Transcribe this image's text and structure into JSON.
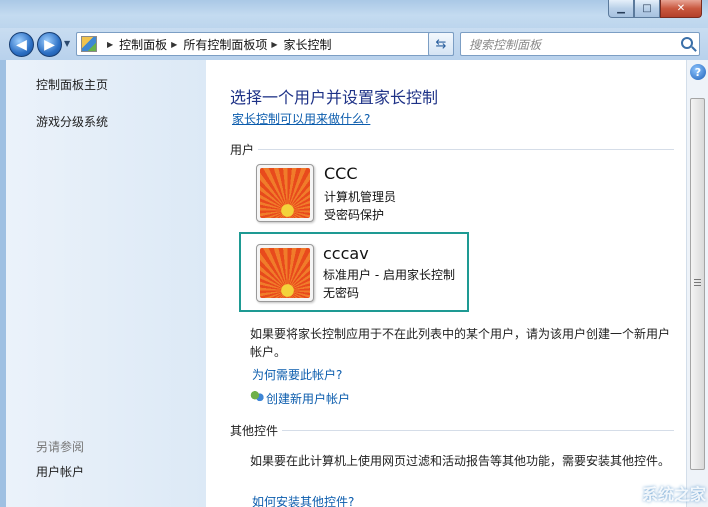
{
  "window": {
    "controls": {
      "minimize": "▁",
      "maximize": "□",
      "close": "✕"
    }
  },
  "address": {
    "crumbs": [
      "控制面板",
      "所有控制面板项",
      "家长控制"
    ],
    "search_placeholder": "搜索控制面板"
  },
  "sidebar": {
    "items": [
      "控制面板主页",
      "游戏分级系统"
    ],
    "see_also_label": "另请参阅",
    "see_also_items": [
      "用户帐户"
    ]
  },
  "main": {
    "heading": "选择一个用户并设置家长控制",
    "help_link": "家长控制可以用来做什么?",
    "users_section": "用户",
    "users": [
      {
        "name": "CCC",
        "role": "计算机管理员",
        "password": "受密码保护"
      },
      {
        "name": "cccav",
        "role": "标准用户 - 启用家长控制",
        "password": "无密码"
      }
    ],
    "create_note": "如果要将家长控制应用于不在此列表中的某个用户，请为该用户创建一个新用户帐户。",
    "why_link": "为何需要此帐户?",
    "create_link": "创建新用户帐户",
    "other_section": "其他控件",
    "other_note": "如果要在此计算机上使用网页过滤和活动报告等其他功能，需要安装其他控件。",
    "other_link": "如何安装其他控件?"
  },
  "icons": {
    "back": "back-arrow-icon",
    "forward": "forward-arrow-icon",
    "refresh": "refresh-icon",
    "search": "search-icon",
    "help": "help-icon"
  },
  "colors": {
    "heading": "#1e3287",
    "link": "#0b5cad",
    "selected_border": "#1e9a93"
  },
  "watermark": "系统之家"
}
